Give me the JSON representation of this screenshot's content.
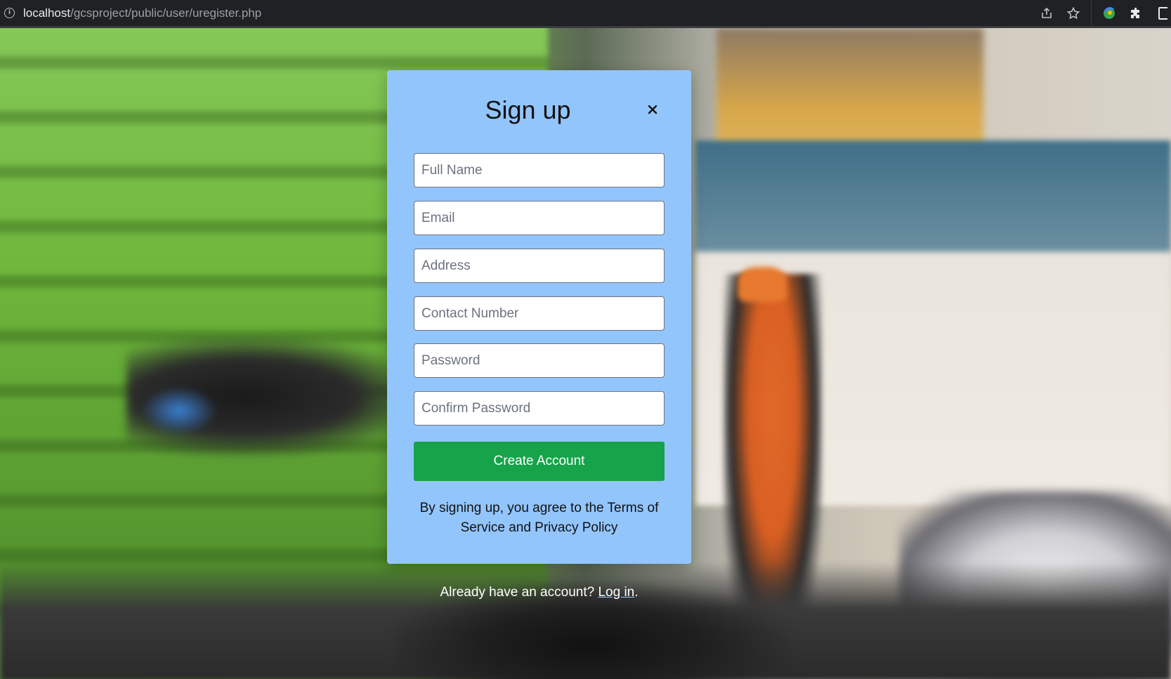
{
  "browser": {
    "url_host": "localhost",
    "url_path": "/gcsproject/public/user/uregister.php",
    "icons": [
      "info-icon",
      "share-icon",
      "star-icon",
      "profile-icon",
      "puzzle-icon",
      "sidebar-icon"
    ]
  },
  "modal": {
    "title": "Sign up",
    "close_symbol": "×",
    "fields": [
      {
        "name": "full-name",
        "placeholder": "Full Name",
        "value": ""
      },
      {
        "name": "email",
        "placeholder": "Email",
        "value": ""
      },
      {
        "name": "address",
        "placeholder": "Address",
        "value": ""
      },
      {
        "name": "contact-number",
        "placeholder": "Contact Number",
        "value": ""
      },
      {
        "name": "password",
        "placeholder": "Password",
        "value": ""
      },
      {
        "name": "confirm-password",
        "placeholder": "Confirm Password",
        "value": ""
      }
    ],
    "submit_label": "Create Account",
    "terms_text": "By signing up, you agree to the Terms of Service and Privacy Policy"
  },
  "footer": {
    "prompt": "Already have an account?",
    "login_link": "Log in",
    "suffix": "."
  },
  "colors": {
    "modal_bg": "#93c5fd",
    "button_bg": "#16a34a",
    "browser_bar": "#202124"
  }
}
